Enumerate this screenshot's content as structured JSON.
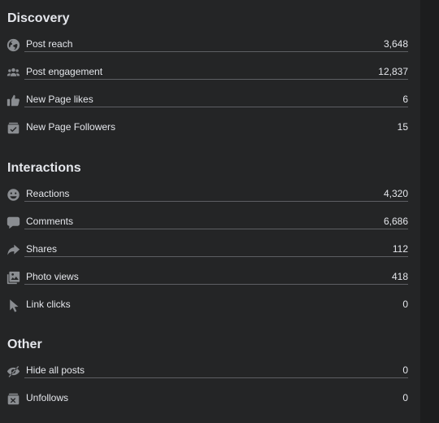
{
  "sections": {
    "discovery": {
      "title": "Discovery",
      "items": [
        {
          "label": "Post reach",
          "value": "3,648",
          "icon": "globe-icon"
        },
        {
          "label": "Post engagement",
          "value": "12,837",
          "icon": "people-icon"
        },
        {
          "label": "New Page likes",
          "value": "6",
          "icon": "thumbs-up-icon"
        },
        {
          "label": "New Page Followers",
          "value": "15",
          "icon": "follow-box-icon"
        }
      ]
    },
    "interactions": {
      "title": "Interactions",
      "items": [
        {
          "label": "Reactions",
          "value": "4,320",
          "icon": "smiley-icon"
        },
        {
          "label": "Comments",
          "value": "6,686",
          "icon": "comment-icon"
        },
        {
          "label": "Shares",
          "value": "112",
          "icon": "share-arrow-icon"
        },
        {
          "label": "Photo views",
          "value": "418",
          "icon": "photo-icon"
        },
        {
          "label": "Link clicks",
          "value": "0",
          "icon": "cursor-icon"
        }
      ]
    },
    "other": {
      "title": "Other",
      "items": [
        {
          "label": "Hide all posts",
          "value": "0",
          "icon": "hidden-eye-icon"
        },
        {
          "label": "Unfollows",
          "value": "0",
          "icon": "unfollow-box-icon"
        }
      ]
    }
  },
  "colors": {
    "panel_bg": "#242526",
    "page_bg": "#18191a",
    "text": "#e4e6eb",
    "icon": "#8a8d91",
    "underline": "#5d5f63"
  }
}
